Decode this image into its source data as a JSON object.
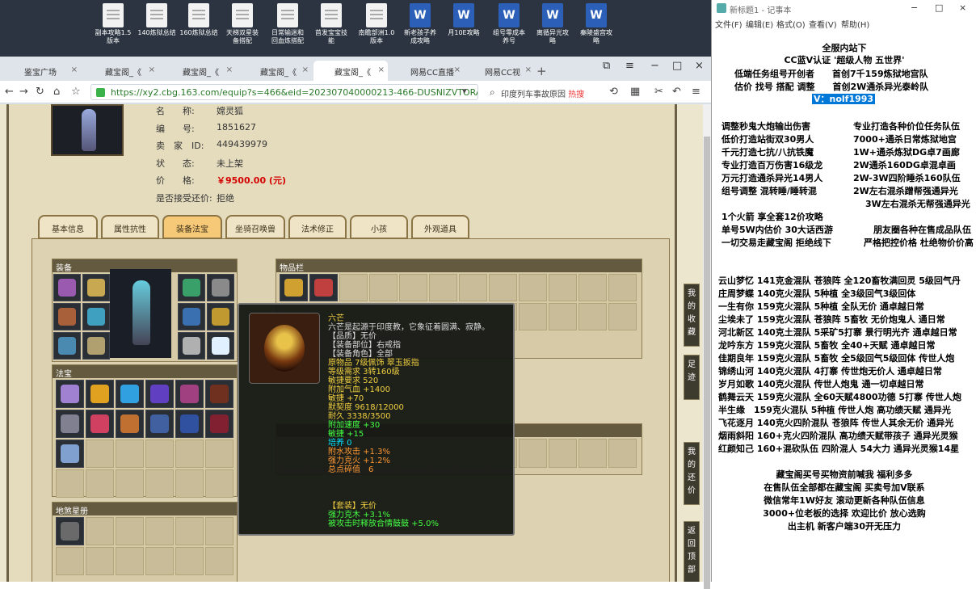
{
  "desktop": {
    "icons": [
      {
        "label1": "副本攻略1.5",
        "label2": "版本",
        "kind": "doc"
      },
      {
        "label1": "140炼狱总结",
        "label2": "",
        "kind": "doc"
      },
      {
        "label1": "160炼狱总结",
        "label2": "",
        "kind": "doc"
      },
      {
        "label1": "天梯双星装",
        "label2": "备搭配",
        "kind": "doc"
      },
      {
        "label1": "日常输迷和",
        "label2": "回血炼搭配",
        "kind": "doc"
      },
      {
        "label1": "首发宝宝技",
        "label2": "能",
        "kind": "doc"
      },
      {
        "label1": "南瞻部洲1.0",
        "label2": "版本",
        "kind": "doc"
      },
      {
        "label1": "新老孩子养",
        "label2": "成攻略",
        "kind": "word"
      },
      {
        "label1": "月10E攻略",
        "label2": "",
        "kind": "word"
      },
      {
        "label1": "组号零成本",
        "label2": "养号",
        "kind": "word"
      },
      {
        "label1": "离循异光攻",
        "label2": "略",
        "kind": "word"
      },
      {
        "label1": "秦陵盛宫攻",
        "label2": "略",
        "kind": "word"
      }
    ]
  },
  "browser": {
    "tabs": [
      {
        "label": "鉴宝广场",
        "color": "#3ba0e0"
      },
      {
        "label": "藏宝阁_《",
        "color": "#f0a020"
      },
      {
        "label": "藏宝阁_《",
        "color": "#f0a020"
      },
      {
        "label": "藏宝阁_《",
        "color": "#f0a020"
      },
      {
        "label": "藏宝阁_《",
        "color": "#f0a020"
      },
      {
        "label": "网易CC直播",
        "color": "#2a7ae0"
      },
      {
        "label": "网易CC视",
        "color": "#2a7ae0"
      }
    ],
    "new_tab": "+",
    "url": "https://xy2.cbg.163.com/equip?s=466&eid=202307040000213-466-DUSNIZVTORAZ",
    "search_placeholder": "印度列车事故原因",
    "search_hot": "热搜"
  },
  "equip": {
    "rows": [
      {
        "k": "名　　称:",
        "v": "嫦灵狐"
      },
      {
        "k": "编　　号:",
        "v": "1851627"
      },
      {
        "k": "卖　家　ID:",
        "v": "449439979"
      },
      {
        "k": "状　　态:",
        "v": "未上架"
      },
      {
        "k": "价　　格:",
        "v": "￥9500.00 (元)"
      },
      {
        "k": "是否接受还价:",
        "v": "拒绝"
      }
    ],
    "tabs": [
      "基本信息",
      "属性抗性",
      "装备法宝",
      "坐骑召唤兽",
      "法术修正",
      "小孩",
      "外观道具"
    ],
    "panel_equip": "装备",
    "panel_items": "物品栏",
    "panel_fabao": "法宝",
    "panel_ling": "地煞星册"
  },
  "tooltip": {
    "name": "六芒",
    "desc": "六芒是起源于印度教，它象征着圆满、寂静。",
    "lines": [
      {
        "t": "【品质】无价",
        "cls": "w"
      },
      {
        "t": "【装备部位】右戒指",
        "cls": "w"
      },
      {
        "t": "【装备角色】全部",
        "cls": "w"
      },
      {
        "t": "原物品 7级佩饰 翠玉扳指",
        "cls": "y"
      },
      {
        "t": "等级需求 3转160级",
        "cls": "y"
      },
      {
        "t": "敏捷要求 520",
        "cls": "y"
      },
      {
        "t": "附加气血 +1400",
        "cls": "y"
      },
      {
        "t": "敏捷 +70",
        "cls": "y"
      },
      {
        "t": "默契度 9618/12000",
        "cls": "y"
      },
      {
        "t": "耐久 3338/3500",
        "cls": "y"
      },
      {
        "t": "附加速度 +30",
        "cls": "gr"
      },
      {
        "t": "敏捷 +15",
        "cls": "gr"
      },
      {
        "t": "培养 0",
        "cls": "c"
      },
      {
        "t": "附水攻击 +1.3%",
        "cls": "o"
      },
      {
        "t": "强力克火 +1.2%",
        "cls": "o"
      },
      {
        "t": "总点碎值　6",
        "cls": "o"
      }
    ],
    "set_lines": [
      {
        "t": "【套装】无价",
        "cls": "y"
      },
      {
        "t": "强力克木 +3.1%",
        "cls": "gr"
      },
      {
        "t": "被攻击时释放合情鼓鼓 +5.0%",
        "cls": "gr"
      }
    ]
  },
  "side_buttons": [
    "我的收藏",
    "足迹",
    "我的还价",
    "返回顶部"
  ],
  "notepad": {
    "title": "新标题1 - 记事本",
    "menu": [
      "文件(F)",
      "编辑(E)",
      "格式(O)",
      "查看(V)",
      "帮助(H)"
    ],
    "header": [
      "全服内站下",
      "CC蓝V认证 '超级人物 五世界'",
      "低端任务组号开创者　　首创7千159炼狱地宫队",
      "估价 找号 搭配 调整　　首创2W通杀异光泰岭队"
    ],
    "contact": "V：nolf1993",
    "services": [
      [
        "调整秒鬼大炮输出伤害",
        "专业打造各种价位任务队伍"
      ],
      [
        "低价打造站街双30男人",
        "7000+通杀日常炼狱地宫"
      ],
      [
        "千元打造七抗/八抗铁魔",
        "1W+通杀炼狱DG卓7画廊"
      ],
      [
        "专业打造百万伤害16级龙",
        "2W通杀160DG卓混卓画"
      ],
      [
        "万元打造通杀异光14男人",
        "2W-3W四阶睡杀160队伍"
      ],
      [
        "组号调整 混转睡/睡转混",
        "2W左右混杀蹭帮强通异光"
      ],
      [
        "",
        "3W左右混杀无帮强通异光"
      ]
    ],
    "promo": [
      [
        "1个火箭 享全套12价攻略",
        ""
      ],
      [
        "单号5W内估价 30大话西游",
        "朋友圈各种在售成品队伍"
      ],
      [
        "一切交易走藏宝阁 拒绝线下",
        "严格把控价格 杜绝物价价高"
      ]
    ],
    "teams": [
      "云山梦忆 141克金混队 苍狼阵 全120畜牧满回灵 5级回气丹",
      "庄周梦蝶 140克火混队 5种植 全3级回气3级回体",
      "一生有你 159克火混队 5种植 全队无价 通卓越日常",
      "尘埃未了 159克火混队 苍狼阵 5畜牧 无价炮鬼人 通日常",
      "河北新区 140克土混队 5采矿5打寨 景行明光齐 通卓越日常",
      "龙吟东方 159克火混队 5畜牧 全40+天赋 通卓越日常",
      "佳期良年 159克火混队 5畜牧 全5级回气5级回体 传世人炮",
      "锦绣山河 140克火混队 4打寨 传世炮无价人 通卓越日常",
      "岁月如歌 140克火混队 传世人炮鬼 通一切卓越日常",
      "鹤舞云天 159克火混队 全60天赋4800功德 5打寨 传世人炮",
      "半生缘　159克火混队 5种植 传世人炮 高功绩天赋 通异光",
      "飞花逐月 140克火四阶混队 苍狼阵 传世人其余无价 通异光",
      "烟雨斜阳 160+克火四阶混队 高功绩天赋带孩子 通异光灵猴",
      "红颜知己 160+混砍队伍 四阶混人 54大力 通异光灵猴14星"
    ],
    "footer": [
      "藏宝阁买号买物资前喊我 福利多多",
      "在售队伍全部都在藏宝阁 买卖号加V联系",
      "微信常年1W好友 滚动更新各种队伍信息",
      "3000+位老板的选择 欢迎比价 放心选购",
      "出主机 新客户端30开无压力"
    ]
  }
}
